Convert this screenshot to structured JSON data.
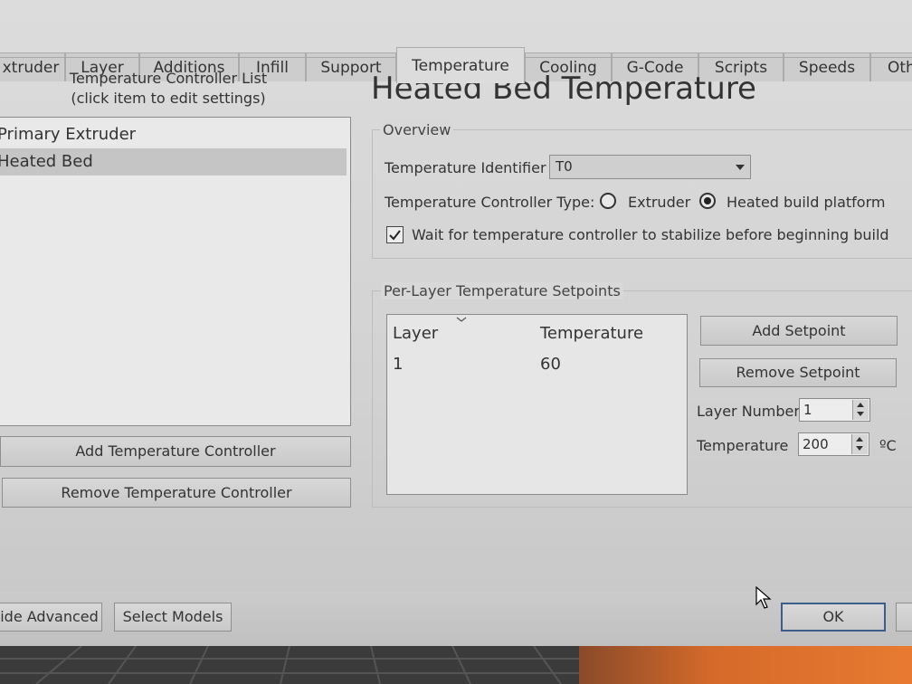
{
  "tabs": [
    {
      "label": "xtruder",
      "active": false
    },
    {
      "label": "Layer",
      "active": false
    },
    {
      "label": "Additions",
      "active": false
    },
    {
      "label": "Infill",
      "active": false
    },
    {
      "label": "Support",
      "active": false
    },
    {
      "label": "Temperature",
      "active": true
    },
    {
      "label": "Cooling",
      "active": false
    },
    {
      "label": "G-Code",
      "active": false
    },
    {
      "label": "Scripts",
      "active": false
    },
    {
      "label": "Speeds",
      "active": false
    },
    {
      "label": "Oth",
      "active": false
    }
  ],
  "left_panel": {
    "caption_line1": "Temperature Controller List",
    "caption_line2": "(click item to edit settings)",
    "controllers": [
      {
        "label": "Primary Extruder",
        "selected": false
      },
      {
        "label": "Heated Bed",
        "selected": true
      }
    ],
    "add_button": "Add Temperature Controller",
    "remove_button": "Remove Temperature Controller"
  },
  "right_panel": {
    "heading": "Heated Bed Temperature",
    "overview": {
      "title": "Overview",
      "identifier_label": "Temperature Identifier",
      "identifier_value": "T0",
      "type_label": "Temperature Controller Type:",
      "type_options": [
        {
          "label": "Extruder",
          "checked": false
        },
        {
          "label": "Heated build platform",
          "checked": true
        }
      ],
      "wait_label": "Wait for temperature controller to stabilize before beginning build",
      "wait_checked": true
    },
    "setpoints": {
      "title": "Per-Layer Temperature Setpoints",
      "columns": [
        "Layer",
        "Temperature"
      ],
      "rows": [
        {
          "layer": "1",
          "temperature": "60"
        }
      ],
      "add_button": "Add Setpoint",
      "remove_button": "Remove Setpoint",
      "layer_number_label": "Layer Number",
      "layer_number_value": "1",
      "temperature_label": "Temperature",
      "temperature_value": "200",
      "temperature_unit": "ºC"
    }
  },
  "footer": {
    "hide_advanced": "ide Advanced",
    "select_models": "Select Models",
    "ok": "OK"
  },
  "colors": {
    "dialog_bg": "#d8d8d8",
    "list_bg": "#e9e9e9",
    "selected_row": "#c5c5c5",
    "ok_border": "#3c5d8c"
  }
}
